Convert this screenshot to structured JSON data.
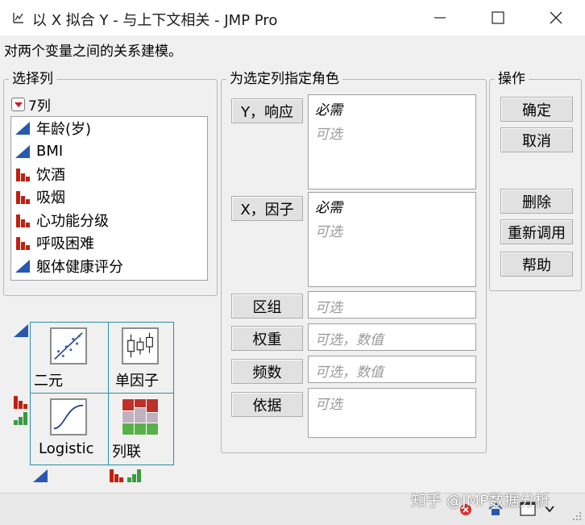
{
  "window": {
    "title": "以 X 拟合 Y - 与上下文相关 - JMP Pro"
  },
  "description": "对两个变量之间的关系建模。",
  "select_columns": {
    "legend": "选择列",
    "count": "7列",
    "items": [
      {
        "label": "年龄(岁)",
        "type": "continuous"
      },
      {
        "label": "BMI",
        "type": "continuous"
      },
      {
        "label": "饮酒",
        "type": "nominal"
      },
      {
        "label": "吸烟",
        "type": "nominal"
      },
      {
        "label": "心功能分级",
        "type": "nominal"
      },
      {
        "label": "呼吸困难",
        "type": "nominal"
      },
      {
        "label": "躯体健康评分",
        "type": "continuous"
      }
    ]
  },
  "roles": {
    "legend": "为选定列指定角色",
    "items": [
      {
        "button": "Y，响应",
        "required": "必需",
        "placeholder": "可选"
      },
      {
        "button": "X，因子",
        "required": "必需",
        "placeholder": "可选"
      },
      {
        "button": "区组",
        "placeholder": "可选"
      },
      {
        "button": "权重",
        "placeholder": "可选，数值"
      },
      {
        "button": "频数",
        "placeholder": "可选，数值"
      },
      {
        "button": "依据",
        "placeholder": "可选"
      }
    ]
  },
  "actions": {
    "legend": "操作",
    "ok": "确定",
    "cancel": "取消",
    "remove": "删除",
    "recall": "重新调用",
    "help": "帮助"
  },
  "analysis_types": [
    {
      "label": "二元",
      "icon": "scatter-plot-icon"
    },
    {
      "label": "单因子",
      "icon": "box-plot-icon"
    },
    {
      "label": "Logistic",
      "icon": "logistic-curve-icon"
    },
    {
      "label": "列联",
      "icon": "mosaic-plot-icon"
    }
  ],
  "watermark": "知乎 @JMP数据分析",
  "colors": {
    "continuous_icon": "#2858b0",
    "nominal_icon": "#c02010",
    "ordinal_icon": "#3a9a40",
    "palette_border": "#2a8fa8",
    "red_triangle": "#d01818"
  }
}
